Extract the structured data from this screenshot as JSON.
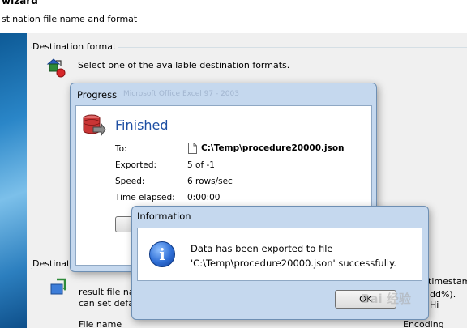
{
  "wizard": {
    "title": "wizard",
    "subtitle": "stination file name and format",
    "destination_format_group": "Destination format",
    "destination_format_hint": "Select one of the available destination formats.",
    "destination_group_partial": "Destinatio",
    "result_text_line1": "result file nam",
    "result_text_line2": "can set defau",
    "right_text_1": "timestamp",
    "right_text_2": "dd%). Hi",
    "file_name_label": "File name",
    "encoding_label": "Encoding"
  },
  "progress_dialog": {
    "title": "Progress",
    "background_faded_text": "Microsoft Office Excel 97 - 2003",
    "status": "Finished",
    "fields": [
      {
        "label": "To:",
        "value": "C:\\Temp\\procedure20000.json"
      },
      {
        "label": "Exported:",
        "value": "5 of -1"
      },
      {
        "label": "Speed:",
        "value": "6 rows/sec"
      },
      {
        "label": "Time elapsed:",
        "value": "0:00:00"
      }
    ]
  },
  "info_dialog": {
    "title": "Information",
    "message_line1": "Data has been exported to file",
    "message_line2": "'C:\\Temp\\procedure20000.json' successfully.",
    "ok_label": "OK",
    "icon": "info-icon"
  },
  "watermark": "Bai 经验"
}
